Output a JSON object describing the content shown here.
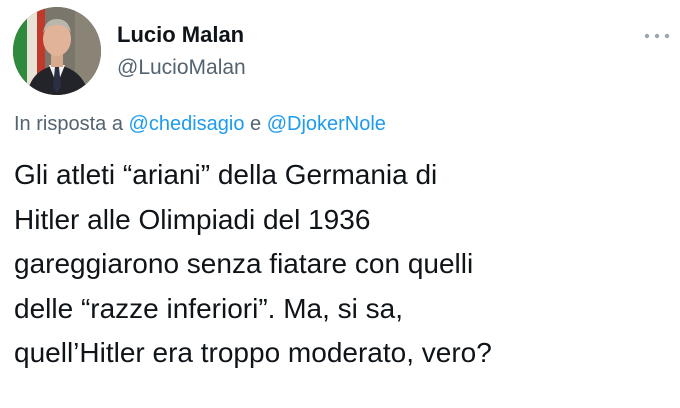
{
  "author": {
    "display_name": "Lucio Malan",
    "handle": "@LucioMalan"
  },
  "icons": {
    "more": "more-horizontal-icon"
  },
  "reply": {
    "prefix": "In risposta a ",
    "mention1": "@chedisagio",
    "conjunction": " e ",
    "mention2": "@DjokerNole"
  },
  "tweet": {
    "lines": [
      "Gli atleti “ariani” della Germania di",
      "Hitler alle Olimpiadi del 1936",
      "gareggiarono senza fiatare con quelli",
      "delle “razze inferiori”. Ma, si sa,",
      "quell’Hitler era troppo moderato, vero?"
    ]
  },
  "colors": {
    "name": "#0f1419",
    "secondary": "#536471",
    "link": "#1d9bf0"
  }
}
